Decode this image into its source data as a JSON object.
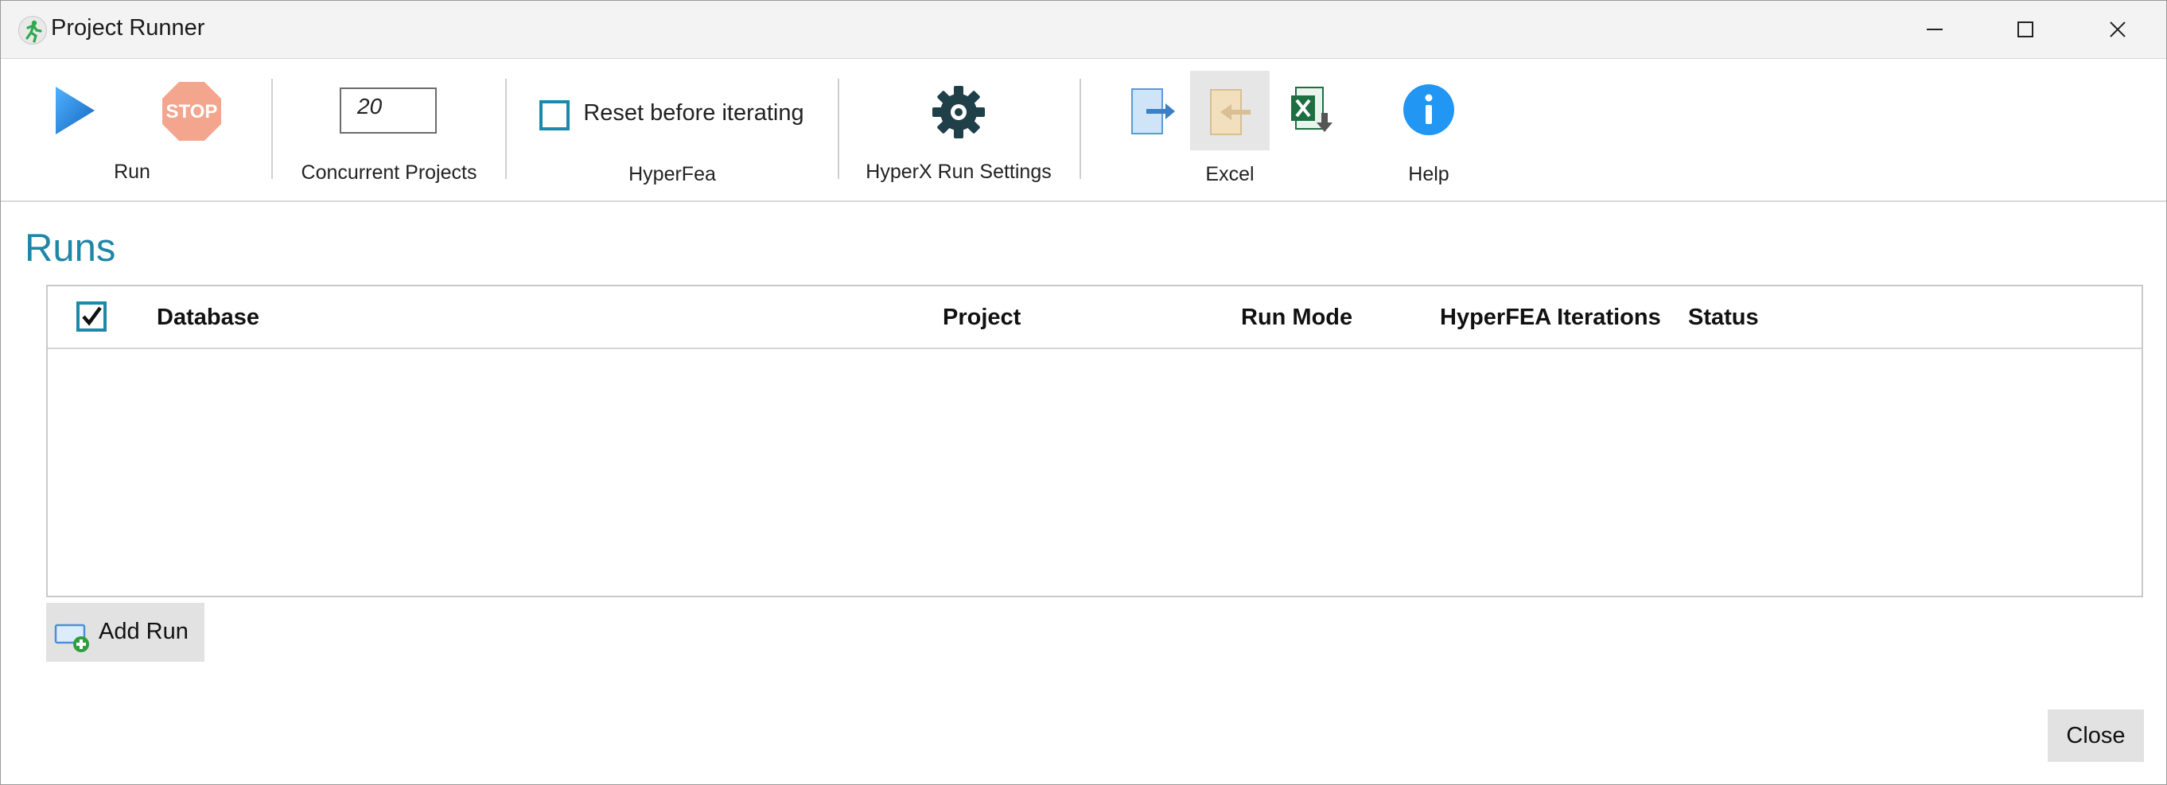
{
  "window": {
    "title": "Project Runner"
  },
  "toolbar": {
    "run_label": "Run",
    "stop_text": "STOP",
    "concurrent_value": "20",
    "concurrent_label": "Concurrent Projects",
    "reset_label": "Reset before iterating",
    "reset_checked": false,
    "hyperfea_label": "HyperFea",
    "settings_label": "HyperX Run Settings",
    "excel_label": "Excel",
    "help_label": "Help"
  },
  "runs": {
    "title": "Runs",
    "select_all_checked": true,
    "columns": [
      "Database",
      "Project",
      "Run Mode",
      "HyperFEA Iterations",
      "Status"
    ],
    "rows": []
  },
  "buttons": {
    "add_run": "Add Run",
    "close": "Close"
  },
  "colors": {
    "accent": "#1c87a7",
    "play": "#1e88e5",
    "stop": "#f4a58e",
    "gear": "#1f3f49",
    "excel": "#1d6f42",
    "help": "#2196f3"
  }
}
